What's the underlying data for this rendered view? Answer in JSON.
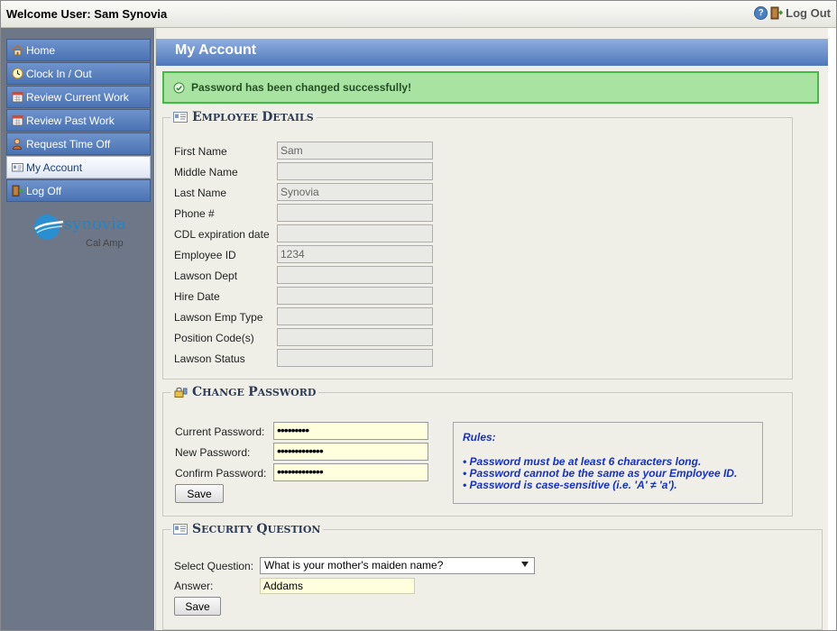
{
  "header": {
    "welcome": "Welcome User: Sam Synovia",
    "logout_label": "Log Out",
    "help_icon": "help-icon",
    "logout_icon": "door-exit-icon"
  },
  "sidebar": {
    "items": [
      {
        "label": "Home",
        "icon": "home-icon"
      },
      {
        "label": "Clock In / Out",
        "icon": "clock-icon"
      },
      {
        "label": "Review Current Work",
        "icon": "calendar-icon"
      },
      {
        "label": "Review Past Work",
        "icon": "calendar-icon"
      },
      {
        "label": "Request Time Off",
        "icon": "person-icon"
      },
      {
        "label": "My Account",
        "icon": "id-card-icon"
      },
      {
        "label": "Log Off",
        "icon": "door-exit-icon"
      }
    ],
    "active_index": 5,
    "logo": {
      "name": "synovia",
      "sub": "Cal Amp"
    }
  },
  "main": {
    "title": "My Account",
    "success_message": "Password has been changed successfully!"
  },
  "employee": {
    "title_cap": "E",
    "title_rest": "MPLOYEE",
    "title_cap2": "D",
    "title_rest2": "ETAILS",
    "fields": [
      {
        "label": "First Name",
        "value": "Sam"
      },
      {
        "label": "Middle Name",
        "value": ""
      },
      {
        "label": "Last Name",
        "value": "Synovia"
      },
      {
        "label": "Phone #",
        "value": ""
      },
      {
        "label": "CDL expiration date",
        "value": ""
      },
      {
        "label": "Employee ID",
        "value": "1234"
      },
      {
        "label": "Lawson Dept",
        "value": ""
      },
      {
        "label": "Hire Date",
        "value": ""
      },
      {
        "label": "Lawson Emp Type",
        "value": ""
      },
      {
        "label": "Position Code(s)",
        "value": ""
      },
      {
        "label": "Lawson Status",
        "value": ""
      }
    ]
  },
  "password": {
    "title_cap": "C",
    "title_rest": "HANGE",
    "title_cap2": "P",
    "title_rest2": "ASSWORD",
    "current_label": "Current Password:",
    "current_value": "•••••••••",
    "new_label": "New Password:",
    "new_value": "•••••••••••••",
    "confirm_label": "Confirm Password:",
    "confirm_value": "•••••••••••••",
    "save_label": "Save",
    "rules_title": "Rules:",
    "rules": [
      "• Password must be at least 6 characters long.",
      "• Password cannot be the same as your Employee ID.",
      "• Password is case-sensitive (i.e. 'A' ≠ 'a')."
    ]
  },
  "security": {
    "title_cap": "S",
    "title_rest": "ECURITY",
    "title_cap2": "Q",
    "title_rest2": "UESTION",
    "select_label": "Select Question:",
    "selected_question": "What is your mother's maiden name?",
    "answer_label": "Answer:",
    "answer_value": "Addams",
    "save_label": "Save"
  }
}
